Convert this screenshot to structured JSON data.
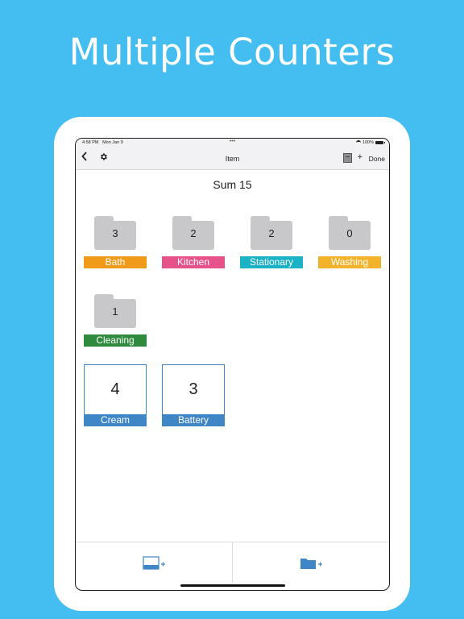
{
  "headline": "Multiple Counters",
  "status_bar": {
    "time": "4:58 PM",
    "date": "Mon Jan 9",
    "battery": "100%"
  },
  "nav": {
    "title": "Item",
    "minus": "−",
    "plus": "+",
    "done": "Done"
  },
  "sum_text": "Sum 15",
  "folders": [
    {
      "label": "Bath",
      "count": "3",
      "color": "#f09a1a"
    },
    {
      "label": "Kitchen",
      "count": "2",
      "color": "#e6528a"
    },
    {
      "label": "Stationary",
      "count": "2",
      "color": "#1ab2c4"
    },
    {
      "label": "Washing",
      "count": "0",
      "color": "#f2b32a"
    },
    {
      "label": "Cleaning",
      "count": "1",
      "color": "#2e8b3e"
    }
  ],
  "counters": [
    {
      "label": "Cream",
      "value": "4"
    },
    {
      "label": "Battery",
      "value": "3"
    }
  ],
  "colors": {
    "background": "#44bdf0",
    "counter_accent": "#3e86c6",
    "folder_gray": "#c8c8ca"
  },
  "icons": {
    "back": "chevron-left-icon",
    "settings": "gear-icon",
    "add_counter": "add-counter-icon",
    "add_folder": "add-folder-icon"
  }
}
